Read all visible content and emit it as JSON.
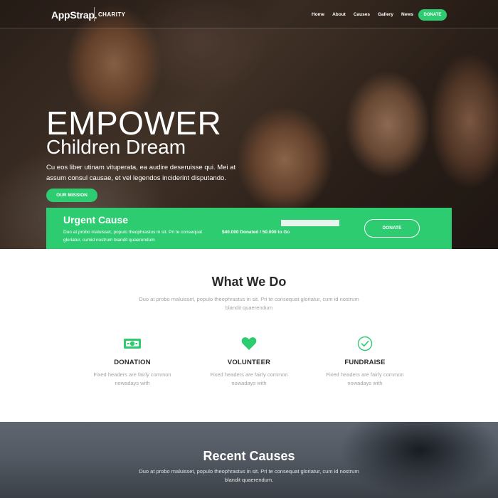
{
  "colors": {
    "accent": "#2ecc71",
    "heading": "#2b2b2b",
    "muted": "#a3a3a3"
  },
  "nav": {
    "logo": "AppStrap.",
    "logo_sub": "CHARITY",
    "links": [
      "Home",
      "About",
      "Causes",
      "Gallery",
      "News"
    ],
    "donate_label": "DONATE"
  },
  "hero": {
    "title": "EMPOWER",
    "subtitle": "Children Dream",
    "text": "Cu eos liber utinam vituperata, ea audire deseruisse qui. Mei at assum consul causae, et vel legendos inciderint disputando.",
    "button_label": "OUR MISSION"
  },
  "urgent": {
    "title": "Urgent Cause",
    "text": "Duo at probo maluisset, populo theophrastus in sit. Pri te consequat gloriatur, cumid nostrum blandit quaerendum",
    "progress": 0.5,
    "progress_label": "$40.000 Donated / 50.000 to Go",
    "donate_label": "DONATE"
  },
  "what_we_do": {
    "title": "What We Do",
    "description": "Duo at probo maluisset, populo theophrastus in sit. Pri te consequat gloriatur, cum id nostrum blandit quaerendum",
    "features": [
      {
        "icon": "money-icon",
        "title": "DONATION",
        "text": "Fixed headers are fairly common nowadays with"
      },
      {
        "icon": "heart-icon",
        "title": "VOLUNTEER",
        "text": "Fixed headers are fairly common nowadays with"
      },
      {
        "icon": "check-circle-icon",
        "title": "FUNDRAISE",
        "text": "Fixed headers are fairly common nowadays with"
      }
    ]
  },
  "recent_causes": {
    "title": "Recent Causes",
    "description": "Duo at probo maluisset, populo theophrastus in sit. Pri te consequat gloriatur, cum id nostrum blandit quaerendum."
  }
}
